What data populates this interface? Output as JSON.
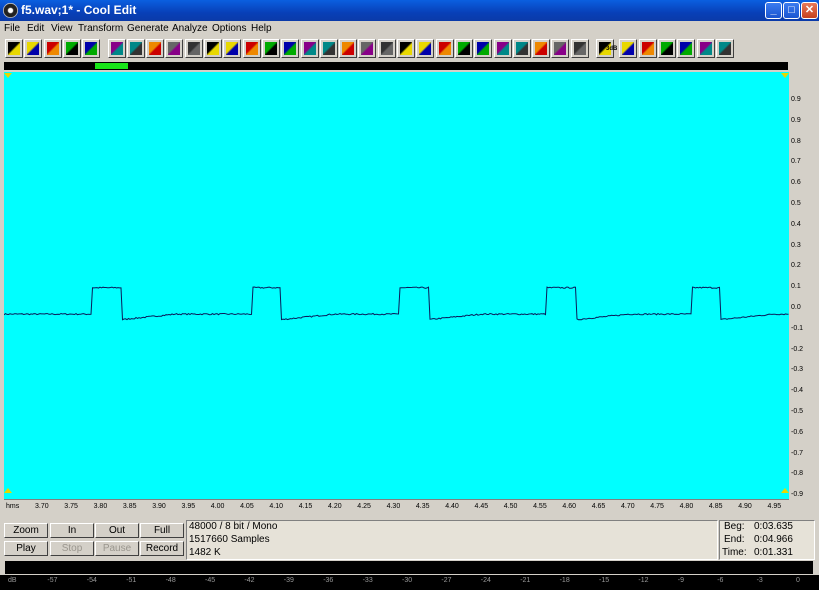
{
  "window": {
    "title": "f5.wav;1* - Cool Edit",
    "minimize_symbol": "_",
    "maximize_symbol": "□",
    "close_symbol": "✕"
  },
  "menu": [
    "File",
    "Edit",
    "View",
    "Transform",
    "Generate",
    "Analyze",
    "Options",
    "Help"
  ],
  "toolbar_icons": [
    "wave-mode-icon",
    "open-file-icon",
    "save-icon",
    "spectral-view-icon",
    "headphones-icon",
    "rewind-icon",
    "silence-icon",
    "loop-icon",
    "note-icon",
    "record-dot-icon",
    "noise-icon",
    "envelope-icon",
    "amplify-icon",
    "spectrum-icon",
    "tone-icon",
    "echo-icon",
    "reverb-icon",
    "flanger-icon",
    "pitch-icon",
    "chorus-icon",
    "filter-icon",
    "distortion-icon",
    "stretch-icon",
    "dynamics-icon",
    "invert-icon",
    "normalize-icon",
    "fade-icon",
    "eq-icon",
    "compress-icon",
    "cue-icon",
    "zero-cross-icon",
    "help-icon",
    "refresh-icon",
    "cd-player-icon",
    "frequency-analysis-icon",
    "marker-icon",
    "scripts-icon"
  ],
  "toolbar_text_badge": "3dB",
  "amplitude_ruler": [
    "0.9",
    "0.9",
    "0.8",
    "0.7",
    "0.6",
    "0.5",
    "0.4",
    "0.3",
    "0.2",
    "0.1",
    "0.0",
    "-0.1",
    "-0.2",
    "-0.3",
    "-0.4",
    "-0.5",
    "-0.6",
    "-0.7",
    "-0.8",
    "-0.9"
  ],
  "time_ruler": {
    "unit": "hms",
    "ticks": [
      "3.70",
      "3.75",
      "3.80",
      "3.85",
      "3.90",
      "3.95",
      "4.00",
      "4.05",
      "4.10",
      "4.15",
      "4.20",
      "4.25",
      "4.30",
      "4.35",
      "4.40",
      "4.45",
      "4.50",
      "4.55",
      "4.60",
      "4.65",
      "4.70",
      "4.75",
      "4.80",
      "4.85",
      "4.90",
      "4.95"
    ]
  },
  "waveform": {
    "color": "#0a1a5a",
    "background": "#00ffff",
    "baseline_level": -0.13,
    "pulse_level": -0.01,
    "pulse_times": [
      3.785,
      4.055,
      4.305,
      4.555,
      4.8
    ],
    "pulse_width_s": 0.05
  },
  "transport": {
    "zoom": "Zoom",
    "in": "In",
    "out": "Out",
    "full": "Full",
    "play": "Play",
    "stop": "Stop",
    "pause": "Pause",
    "record": "Record"
  },
  "file_info": {
    "format": "48000 / 8 bit / Mono",
    "samples": "1517660 Samples",
    "size": "1482 K"
  },
  "selection": {
    "begin_label": "Beg:",
    "begin": "0:03.635",
    "end_label": "End:",
    "end": "0:04.966",
    "time_label": "Time:",
    "time": "0:01.331"
  },
  "level_scale": [
    "dB",
    "-57",
    "-54",
    "-51",
    "-48",
    "-45",
    "-42",
    "-39",
    "-36",
    "-33",
    "-30",
    "-27",
    "-24",
    "-21",
    "-18",
    "-15",
    "-12",
    "-9",
    "-6",
    "-3",
    "0"
  ]
}
